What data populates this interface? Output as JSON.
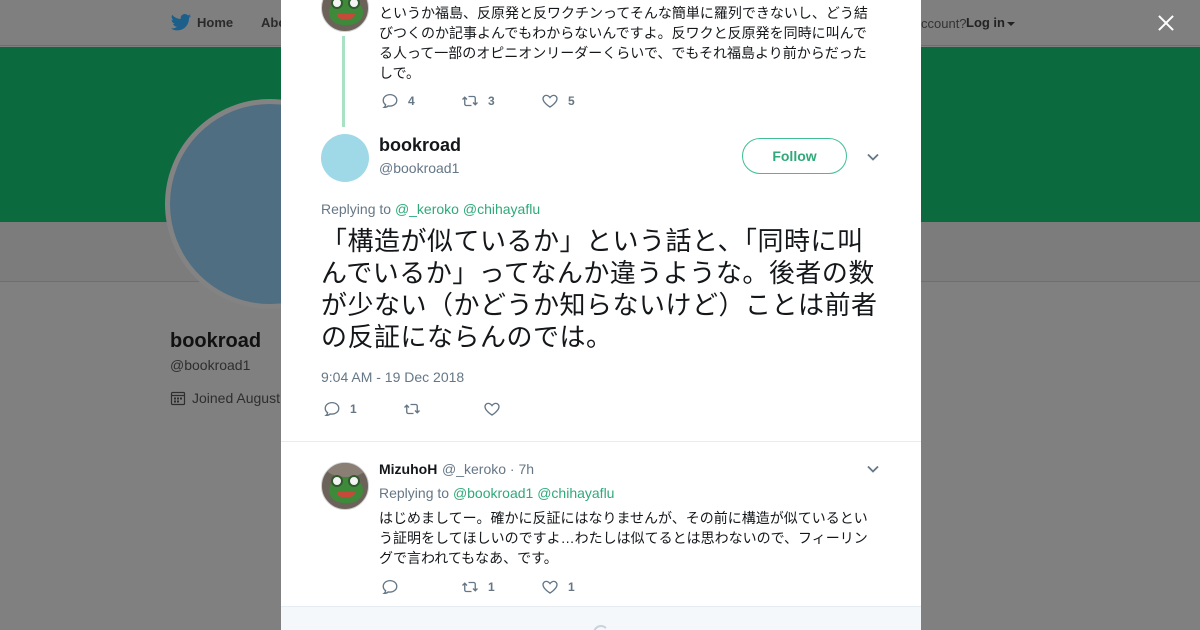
{
  "background": {
    "nav": {
      "home_label": "Home",
      "about_label": "Abo",
      "account_text": "ccount?",
      "login_label": "Log in"
    },
    "profile": {
      "name": "bookroad",
      "handle": "@bookroad1",
      "joined": "Joined August"
    },
    "colors": {
      "banner": "#0b6a3e",
      "overlay": "#808080"
    }
  },
  "parent_tweet": {
    "text": "というか福島、反原発と反ワクチンってそんな簡単に羅列できないし、どう結びつくのか記事よんでもわからないんですよ。反ワクと反原発を同時に叫んでる人って一部のオピニオンリーダーくらいで、でもそれ福島より前からだったしで。",
    "replies": "4",
    "retweets": "3",
    "likes": "5"
  },
  "main_tweet": {
    "name": "bookroad",
    "handle": "@bookroad1",
    "follow_label": "Follow",
    "replying_prefix": "Replying to",
    "mention_1": "@_keroko",
    "mention_2": "@chihayaflu",
    "text": "「構造が似ているか」という話と、「同時に叫んでいるか」ってなんか違うような。後者の数が少ない（かどうか知らないけど）ことは前者の反証にならんのでは。",
    "timestamp": "9:04 AM - 19 Dec 2018",
    "replies": "1",
    "retweets": "",
    "likes": ""
  },
  "reply_tweet": {
    "name": "MizuhoH",
    "handle_time": "@_keroko · 7h",
    "replying_prefix": "Replying to",
    "mention_1": "@bookroad1",
    "mention_2": "@chihayaflu",
    "text": "はじめましてー。確かに反証にはなりませんが、その前に構造が似ているという証明をしてほしいのですよ…わたしは似てるとは思わないので、フィーリングで言われてもなあ、です。",
    "replies": "",
    "retweets": "1",
    "likes": "1"
  },
  "icons": [
    "twitter-bird-icon",
    "calendar-icon",
    "close-icon",
    "reply-icon",
    "retweet-icon",
    "heart-icon",
    "chevron-down-icon",
    "loading-spinner-icon"
  ]
}
